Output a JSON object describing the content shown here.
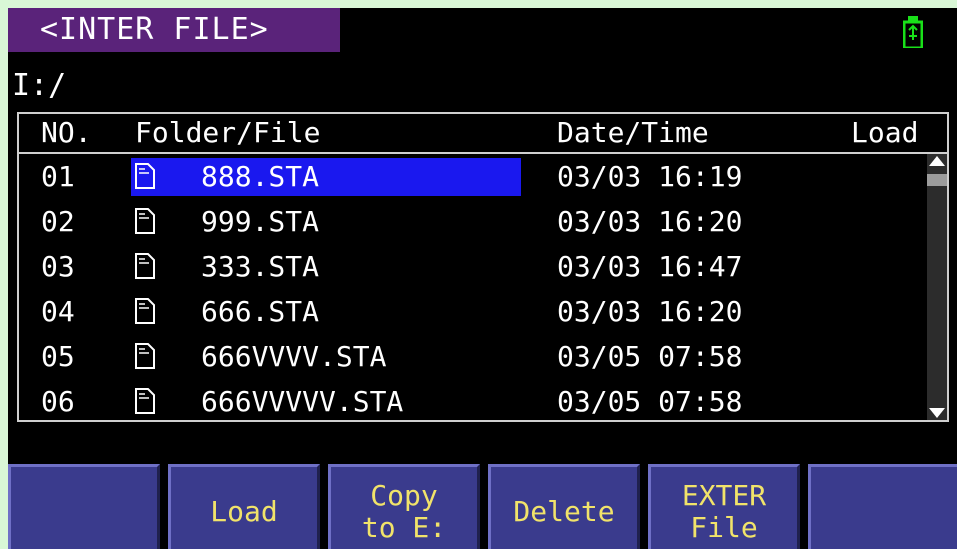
{
  "header": {
    "title": "<INTER FILE>",
    "usb_icon": "usb-drive-icon",
    "usb_color": "#19e019"
  },
  "path": "I:/",
  "table": {
    "columns": {
      "no": "NO.",
      "name": "Folder/File",
      "date": "Date/Time",
      "load": "Load"
    },
    "rows": [
      {
        "no": "01",
        "name": "888.STA",
        "date": "03/03 16:19",
        "selected": true
      },
      {
        "no": "02",
        "name": "999.STA",
        "date": "03/03 16:20"
      },
      {
        "no": "03",
        "name": "333.STA",
        "date": "03/03 16:47"
      },
      {
        "no": "04",
        "name": "666.STA",
        "date": "03/03 16:20"
      },
      {
        "no": "05",
        "name": "666VVVV.STA",
        "date": "03/05 07:58"
      },
      {
        "no": "06",
        "name": "666VVVVV.STA",
        "date": "03/05 07:58"
      }
    ],
    "selection_color": "#1a18ef"
  },
  "softkeys": [
    {
      "line1": "",
      "line2": ""
    },
    {
      "line1": "Load",
      "line2": ""
    },
    {
      "line1": "Copy",
      "line2": "to E:"
    },
    {
      "line1": "Delete",
      "line2": ""
    },
    {
      "line1": "EXTER",
      "line2": "File"
    },
    {
      "line1": "",
      "line2": ""
    }
  ],
  "colors": {
    "background": "#000000",
    "title_bg": "#5a237a",
    "key_bg": "#3a3b8d",
    "key_text": "#f1e36a"
  }
}
